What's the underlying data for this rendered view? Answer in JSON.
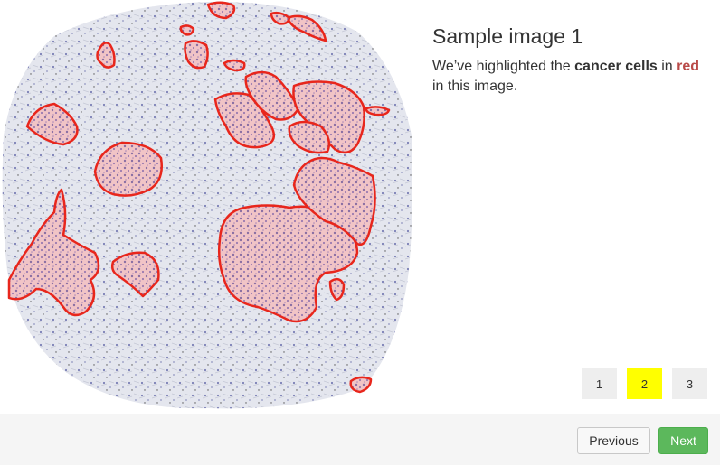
{
  "sample": {
    "title": "Sample image 1",
    "description_parts": {
      "intro": "We’ve highlighted the",
      "highlight_term": "cancer cells",
      "middle": "in",
      "color_word": "red",
      "outro": "in this image."
    }
  },
  "image": {
    "icon": "tissue-slide-image",
    "outline_color": "#e8261c",
    "fill_color": "#f5b5b0"
  },
  "pagination": {
    "pages": [
      "1",
      "2",
      "3"
    ],
    "active_page": "2",
    "active_color": "#ffff00"
  },
  "footer": {
    "previous_label": "Previous",
    "next_label": "Next"
  }
}
